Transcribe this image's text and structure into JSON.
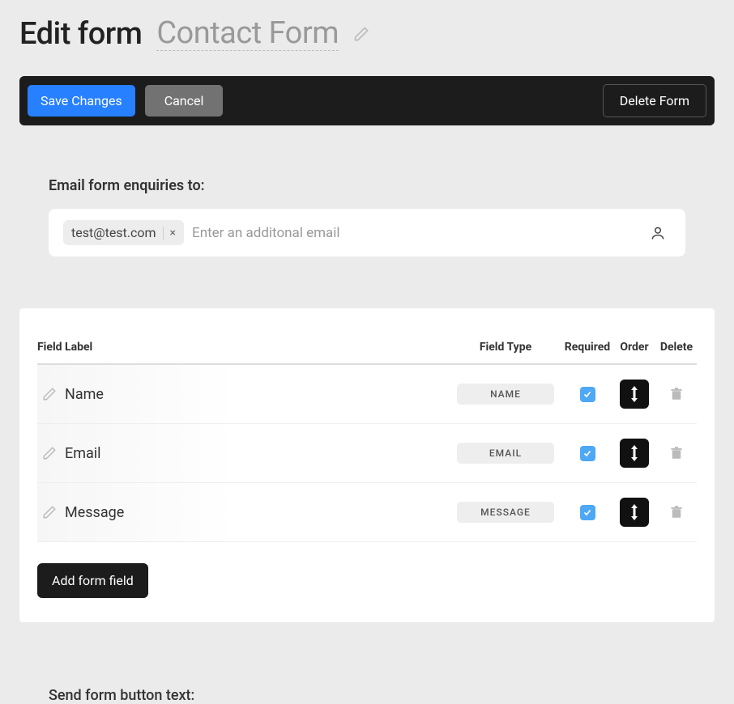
{
  "header": {
    "title": "Edit form",
    "form_name": "Contact Form"
  },
  "actions": {
    "save": "Save Changes",
    "cancel": "Cancel",
    "delete": "Delete Form"
  },
  "email_section": {
    "label": "Email form enquiries to:",
    "chips": [
      "test@test.com"
    ],
    "placeholder": "Enter an additonal email"
  },
  "fields_table": {
    "headers": {
      "label": "Field Label",
      "type": "Field Type",
      "required": "Required",
      "order": "Order",
      "delete": "Delete"
    },
    "rows": [
      {
        "label": "Name",
        "type": "NAME",
        "required": true
      },
      {
        "label": "Email",
        "type": "EMAIL",
        "required": true
      },
      {
        "label": "Message",
        "type": "MESSAGE",
        "required": true
      }
    ]
  },
  "add_field_label": "Add form field",
  "send_button_section": {
    "label": "Send form button text:"
  }
}
